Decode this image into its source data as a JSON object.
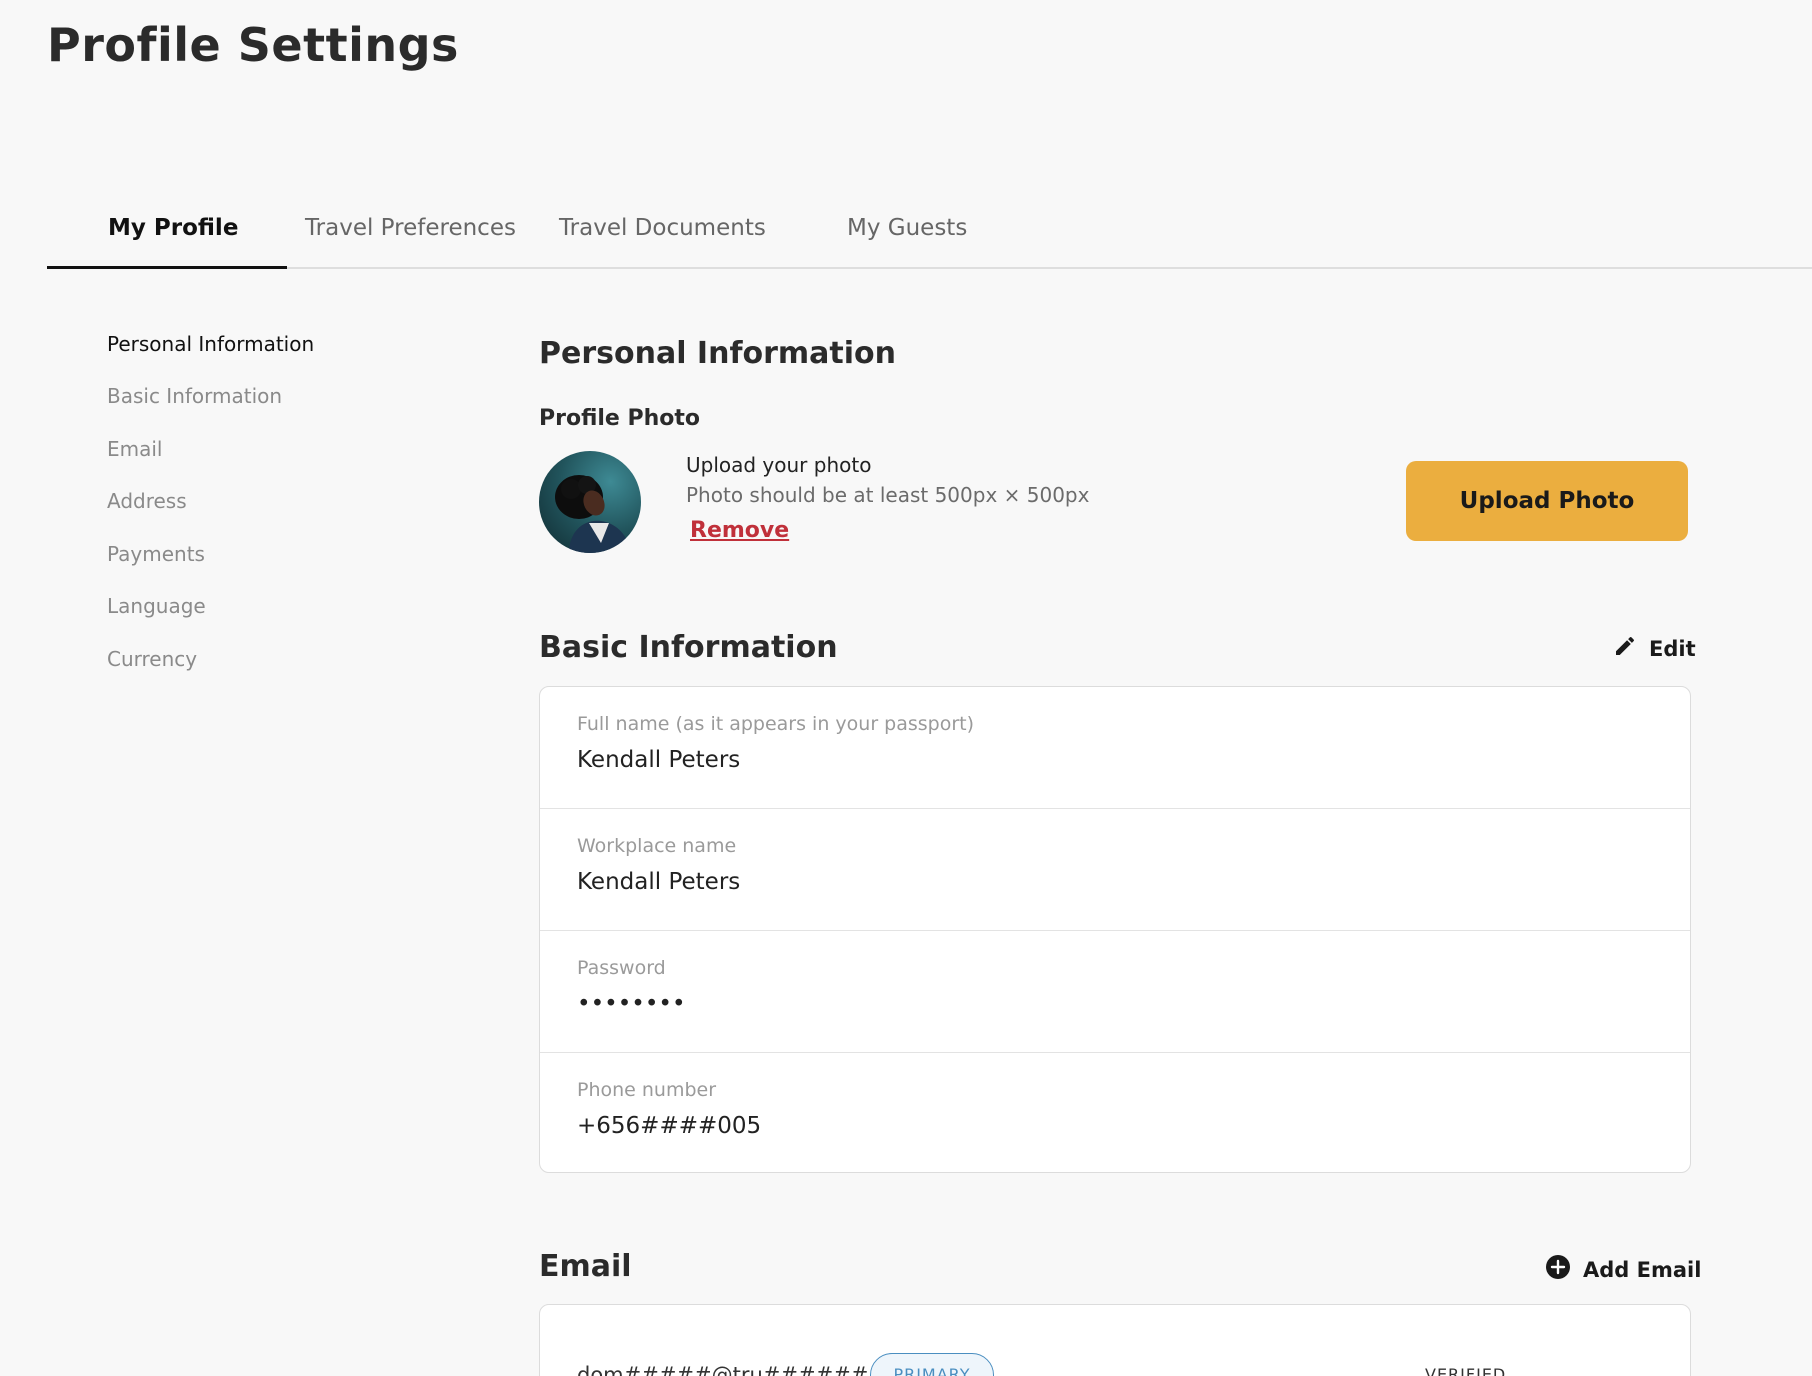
{
  "page": {
    "title": "Profile Settings"
  },
  "tabs": [
    {
      "label": "My Profile",
      "active": true
    },
    {
      "label": "Travel Preferences",
      "active": false
    },
    {
      "label": "Travel Documents",
      "active": false
    },
    {
      "label": "My Guests",
      "active": false
    }
  ],
  "sidenav": {
    "items": [
      {
        "label": "Personal Information",
        "active": true
      },
      {
        "label": "Basic Information",
        "active": false
      },
      {
        "label": "Email",
        "active": false
      },
      {
        "label": "Address",
        "active": false
      },
      {
        "label": "Payments",
        "active": false
      },
      {
        "label": "Language",
        "active": false
      },
      {
        "label": "Currency",
        "active": false
      }
    ]
  },
  "personal": {
    "title": "Personal Information",
    "photo_title": "Profile Photo",
    "upload_text": "Upload your photo",
    "requirement_text": "Photo should be at least 500px × 500px",
    "remove_label": "Remove",
    "upload_button": "Upload Photo"
  },
  "basic": {
    "title": "Basic Information",
    "edit_label": "Edit",
    "fields": [
      {
        "label": "Full name (as it appears in your passport)",
        "value": "Kendall Peters"
      },
      {
        "label": "Workplace name",
        "value": "Kendall Peters"
      },
      {
        "label": "Password",
        "value": "••••••••"
      },
      {
        "label": "Phone number",
        "value": "+656####005"
      }
    ]
  },
  "email": {
    "title": "Email",
    "add_label": "Add Email",
    "entries": [
      {
        "value": "dom#####@tru#######",
        "badge": "PRIMARY",
        "status": "VERIFIED"
      }
    ]
  },
  "colors": {
    "accent": "#ebae3f",
    "danger": "#c0303a",
    "badge": "#4a8ec0",
    "background": "#f8f8f8"
  },
  "icons": {
    "edit": "pencil-icon",
    "add": "plus-circle-icon"
  }
}
